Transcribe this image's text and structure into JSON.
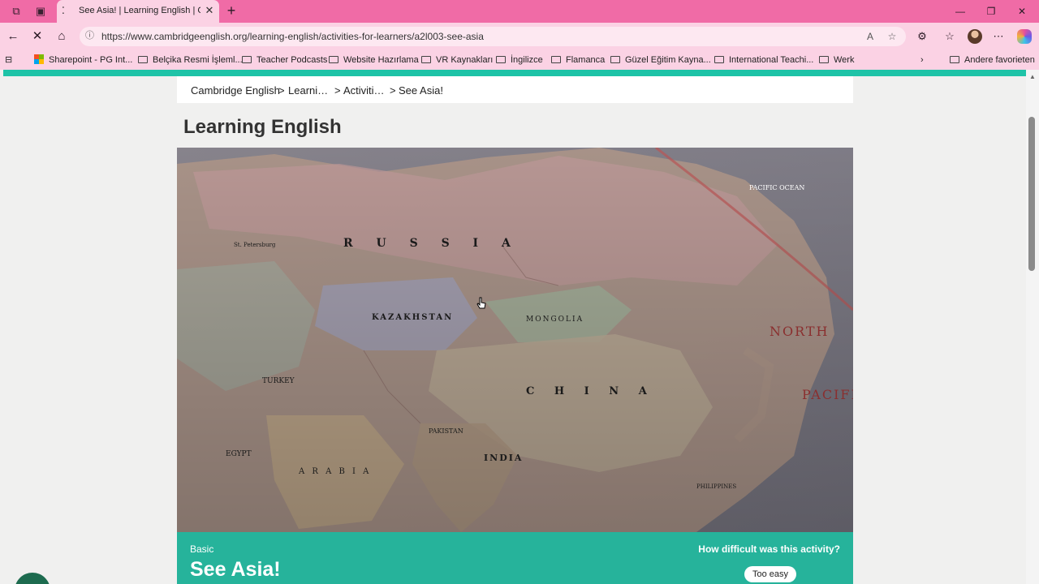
{
  "browser": {
    "tab_title": "See Asia! | Learning English | Cambridge English",
    "url": "https://www.cambridgeenglish.org/learning-english/activities-for-learners/a2l003-see-asia",
    "favorites": [
      "Sharepoint - PG Int...",
      "Belçika Resmi İşleml...",
      "Teacher Podcasts",
      "Website Hazırlama",
      "VR Kaynakları",
      "İngilizce",
      "Flamanca",
      "Güzel Eğitim Kayna...",
      "International Teachi...",
      "Werk"
    ],
    "other_favorites": "Andere favorieten",
    "colors": {
      "frame": "#f06ba6",
      "toolbar": "#fbd2e4"
    }
  },
  "page": {
    "breadcrumb": [
      "Cambridge English",
      "Learni…",
      "Activiti…",
      "See Asia!"
    ],
    "breadcrumb_sep": ">",
    "section_title": "Learning English",
    "map_labels": {
      "russia": "R U S S I A",
      "kazakhstan": "KAZAKHSTAN",
      "mongolia": "MONGOLIA",
      "china": "C H I N A",
      "india": "INDIA",
      "north": "NORTH",
      "pacific": "PACIFIC",
      "pacific_ocean": "PACIFIC OCEAN",
      "arabia": "A R A B I A",
      "turkey": "TURKEY",
      "egypt": "EGYPT",
      "pakistan": "PAKISTAN",
      "philippines": "PHILIPPINES",
      "st_petersburg": "St. Petersburg"
    },
    "activity": {
      "level": "Basic",
      "title": "See Asia!",
      "difficulty_question": "How difficult was this activity?",
      "too_easy_label": "Too easy"
    },
    "colors": {
      "accent": "#1ec3a7",
      "card": "#26b39b"
    }
  }
}
